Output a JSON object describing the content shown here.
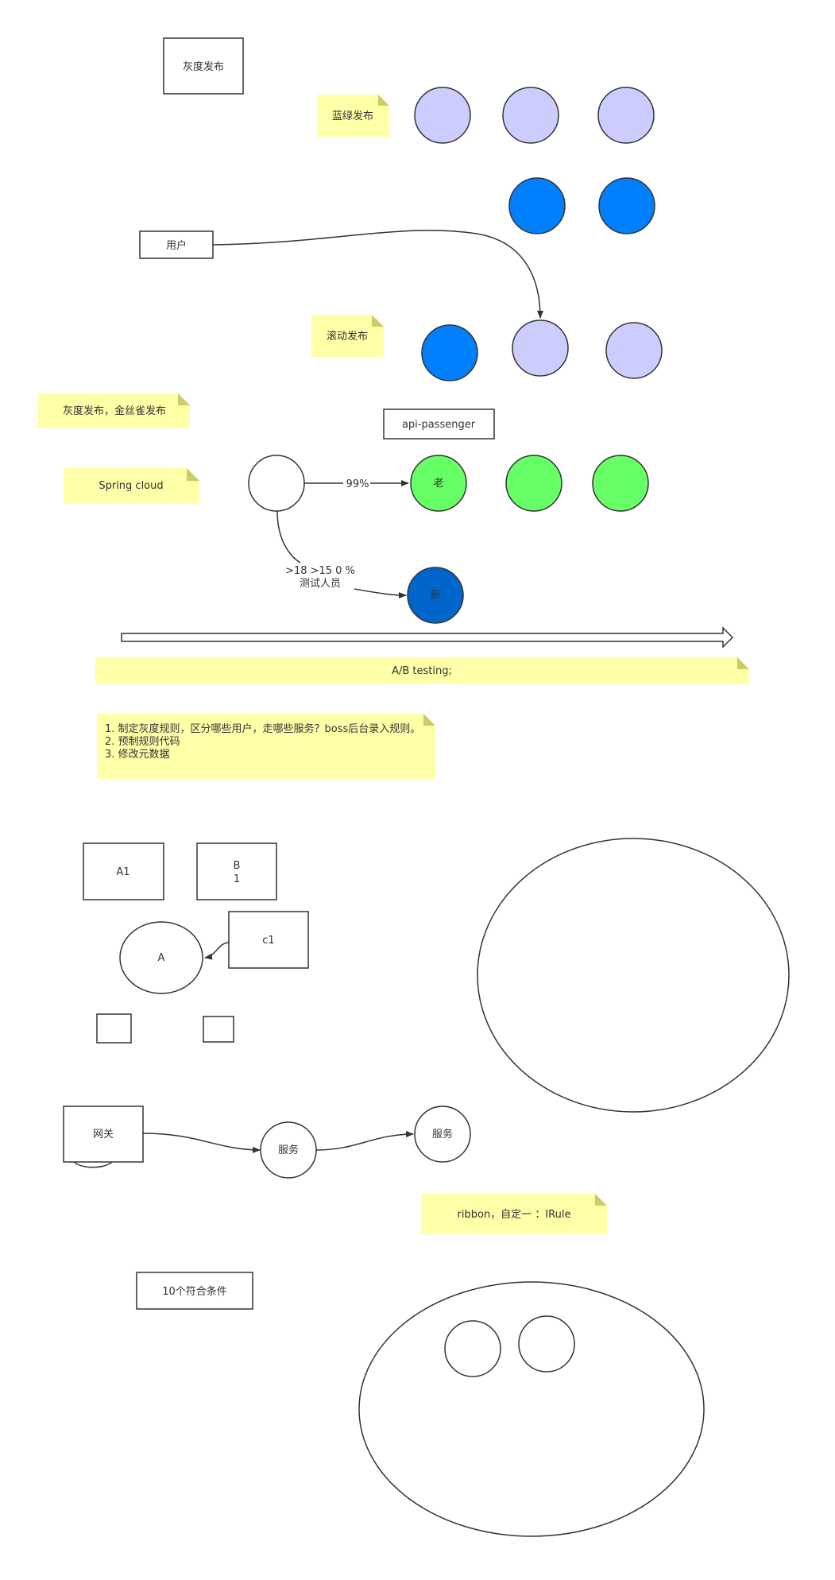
{
  "colors": {
    "lavender": "#ccccff",
    "blue": "#007fff",
    "dark_blue": "#0066cc",
    "green": "#66ff66",
    "note_yellow": "#ffff99",
    "note_fold": "#cccc66",
    "stroke": "#333333"
  },
  "labels": {
    "gray_release": "灰度发布",
    "blue_green_note": "蓝绿发布",
    "user": "用户",
    "rolling_note": "滚动发布",
    "canary_note": "灰度发布，金丝雀发布",
    "api_passenger": "api-passenger",
    "spring_cloud_note": "Spring cloud",
    "old": "老",
    "new": "新",
    "percent_99": "99%",
    "condition_line1": ">18 >15 0 %",
    "condition_line2": "测试人员",
    "ab_testing_note": "A/B testing;",
    "steps": [
      "1. 制定灰度规则，区分哪些用户，走哪些服务？boss后台录入规则。",
      "2. 预制规则代码",
      "3. 修改元数据"
    ],
    "a1": "A1",
    "b1_line1": "B",
    "b1_line2": "1",
    "c1": "c1",
    "a": "A",
    "gateway": "网关",
    "service_1": "服务",
    "service_2": "服务",
    "ribbon_note": "ribbon，自定一 ：IRule",
    "ten_conditions": "10个符合条件"
  }
}
